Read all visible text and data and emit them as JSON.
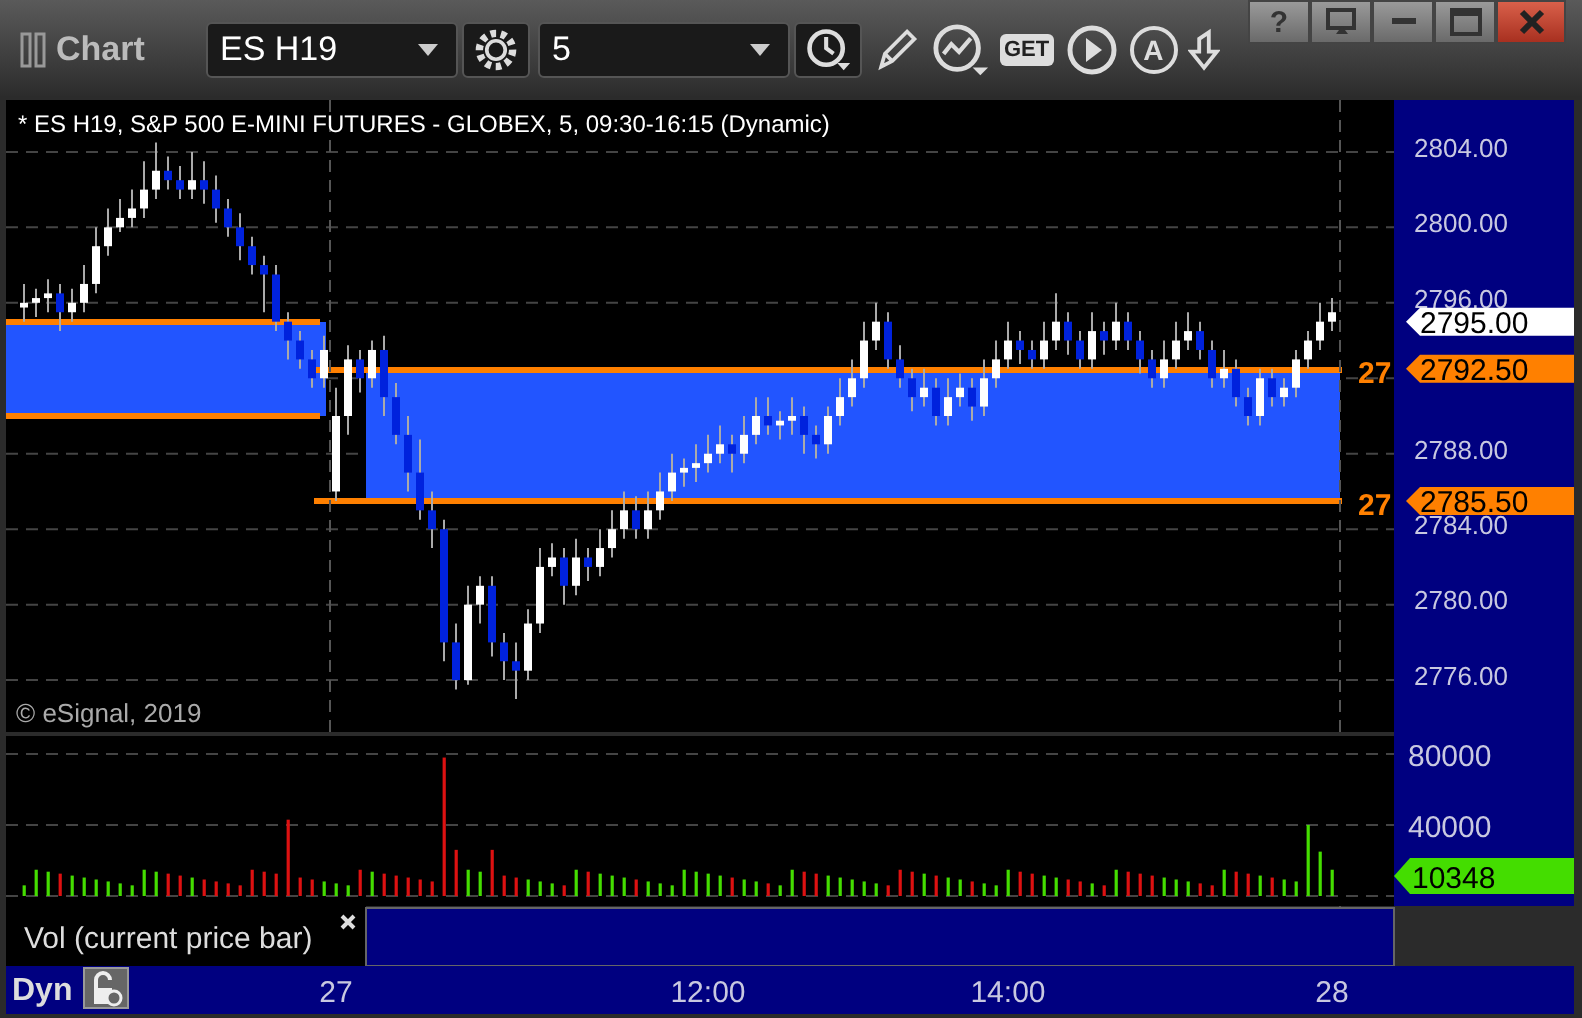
{
  "window": {
    "title": "Chart",
    "help_glyph": "?"
  },
  "toolbar": {
    "symbol": "ES H19",
    "interval": "5",
    "get_label": "GET",
    "a_label": "A"
  },
  "legend": "* ES H19, S&P 500 E-MINI FUTURES - GLOBEX, 5, 09:30-16:15 (Dynamic)",
  "watermark_note": "© eSignal, 2019",
  "price_chart": {
    "chart_data": {
      "type": "candlestick",
      "yticks": [
        {
          "value": 2804,
          "label": "2804.00"
        },
        {
          "value": 2800,
          "label": "2800.00"
        },
        {
          "value": 2796,
          "label": "2796.00"
        },
        {
          "value": 2788,
          "label": "2788.00"
        },
        {
          "value": 2784,
          "label": "2784.00"
        },
        {
          "value": 2780,
          "label": "2780.00"
        },
        {
          "value": 2776,
          "label": "2776.00"
        }
      ],
      "ylim": [
        2773.25,
        2806.75
      ],
      "categories": [
        null,
        null,
        null,
        null,
        null,
        null,
        null,
        null,
        null,
        null,
        null,
        null,
        null,
        null,
        null,
        null,
        null,
        null,
        null,
        null,
        null,
        null,
        null,
        null,
        null,
        null,
        null,
        null,
        null,
        null,
        null,
        null,
        null,
        null,
        null,
        null,
        null,
        null,
        null,
        null,
        null,
        null,
        null,
        null,
        null,
        null,
        null,
        null,
        null,
        null,
        null,
        null,
        null,
        null,
        null,
        null,
        null,
        null,
        null,
        null,
        null,
        null,
        null,
        null,
        null,
        null,
        null,
        null,
        null,
        null,
        null,
        null,
        null,
        null,
        null,
        null,
        null,
        null,
        null,
        null,
        null,
        null,
        null,
        null,
        null,
        null,
        null,
        null,
        null,
        null,
        null,
        null,
        null,
        null,
        null,
        null,
        null,
        null,
        null,
        null,
        null,
        null,
        null,
        null,
        null,
        null,
        null,
        null,
        null,
        null
      ],
      "ohlc": [
        [
          2795.75,
          2797,
          2795,
          2796
        ],
        [
          2796,
          2796.75,
          2795.25,
          2796.25
        ],
        [
          2796.25,
          2797.25,
          2795.5,
          2796.5
        ],
        [
          2796.5,
          2797,
          2794.5,
          2795.5
        ],
        [
          2795.5,
          2796.75,
          2795,
          2796
        ],
        [
          2796,
          2798,
          2795.5,
          2797
        ],
        [
          2797,
          2800,
          2796.5,
          2799
        ],
        [
          2799,
          2801,
          2798.5,
          2800
        ],
        [
          2800,
          2801.5,
          2799.75,
          2800.5
        ],
        [
          2800.5,
          2802,
          2800,
          2801
        ],
        [
          2801,
          2803.5,
          2800.5,
          2802
        ],
        [
          2802,
          2804.5,
          2801.5,
          2803
        ],
        [
          2803,
          2803.75,
          2802,
          2802.5
        ],
        [
          2802.5,
          2803.25,
          2801.5,
          2802
        ],
        [
          2802,
          2804,
          2801.5,
          2802.5
        ],
        [
          2802.5,
          2803.5,
          2801.25,
          2802
        ],
        [
          2802,
          2802.75,
          2800.25,
          2801
        ],
        [
          2801,
          2801.5,
          2799.5,
          2800
        ],
        [
          2800,
          2800.75,
          2798.25,
          2799
        ],
        [
          2799,
          2799.5,
          2797.5,
          2798
        ],
        [
          2798,
          2798.5,
          2795.5,
          2797.5
        ],
        [
          2797.5,
          2798,
          2794.5,
          2795
        ],
        [
          2795,
          2795.5,
          2793,
          2794
        ],
        [
          2794,
          2794.5,
          2792.5,
          2793
        ],
        [
          2793,
          2793.5,
          2791.5,
          2792
        ],
        [
          2792,
          2794.25,
          2791.5,
          2793.5
        ],
        [
          2786,
          2791.5,
          2785.5,
          2790
        ],
        [
          2790,
          2793.75,
          2789,
          2793
        ],
        [
          2793,
          2793.5,
          2791.25,
          2792
        ],
        [
          2792,
          2794,
          2791.5,
          2793.5
        ],
        [
          2793.5,
          2794.25,
          2790,
          2791
        ],
        [
          2791,
          2791.75,
          2788.5,
          2789
        ],
        [
          2789,
          2790,
          2786,
          2787
        ],
        [
          2787,
          2788.75,
          2784.5,
          2785
        ],
        [
          2785,
          2786,
          2783,
          2784
        ],
        [
          2784,
          2784.5,
          2777,
          2778
        ],
        [
          2778,
          2779,
          2775.5,
          2776
        ],
        [
          2776,
          2781,
          2775.75,
          2780
        ],
        [
          2780,
          2781.5,
          2779,
          2781
        ],
        [
          2781,
          2781.5,
          2777.25,
          2778
        ],
        [
          2778,
          2778.5,
          2776,
          2777
        ],
        [
          2777,
          2778,
          2775,
          2776.5
        ],
        [
          2776.5,
          2779.75,
          2776,
          2779
        ],
        [
          2779,
          2783,
          2778.5,
          2782
        ],
        [
          2782,
          2783.25,
          2781.5,
          2782.5
        ],
        [
          2782.5,
          2783,
          2780,
          2781
        ],
        [
          2781,
          2783.5,
          2780.5,
          2782.5
        ],
        [
          2782.5,
          2783,
          2781.25,
          2782
        ],
        [
          2782,
          2784,
          2781.5,
          2783
        ],
        [
          2783,
          2785,
          2782.5,
          2784
        ],
        [
          2784,
          2786,
          2783.5,
          2785
        ],
        [
          2785,
          2785.75,
          2783.5,
          2784
        ],
        [
          2784,
          2786,
          2783.5,
          2785
        ],
        [
          2785,
          2787,
          2784.5,
          2786
        ],
        [
          2786,
          2788,
          2785.5,
          2787
        ],
        [
          2787,
          2787.75,
          2786.25,
          2787.25
        ],
        [
          2787.25,
          2788.5,
          2786.5,
          2787.5
        ],
        [
          2787.5,
          2789,
          2787,
          2788
        ],
        [
          2788,
          2789.5,
          2787.5,
          2788.5
        ],
        [
          2788.5,
          2789,
          2787,
          2788
        ],
        [
          2788,
          2790,
          2787.5,
          2789
        ],
        [
          2789,
          2791,
          2788.5,
          2790
        ],
        [
          2790,
          2791,
          2789,
          2789.5
        ],
        [
          2789.5,
          2790.25,
          2788.75,
          2789.75
        ],
        [
          2789.75,
          2791,
          2789,
          2790
        ],
        [
          2790,
          2790.5,
          2788,
          2789
        ],
        [
          2789,
          2789.5,
          2787.75,
          2788.5
        ],
        [
          2788.5,
          2790.5,
          2788,
          2790
        ],
        [
          2790,
          2792,
          2789.5,
          2791
        ],
        [
          2791,
          2793,
          2790.5,
          2792
        ],
        [
          2792,
          2795,
          2791.5,
          2794
        ],
        [
          2794,
          2796,
          2793.5,
          2795
        ],
        [
          2795,
          2795.5,
          2792.5,
          2793
        ],
        [
          2793,
          2793.75,
          2791.5,
          2792
        ],
        [
          2792,
          2792.5,
          2790.25,
          2791
        ],
        [
          2791,
          2792.5,
          2790.5,
          2791.5
        ],
        [
          2791.5,
          2792,
          2789.5,
          2790
        ],
        [
          2790,
          2792,
          2789.5,
          2791
        ],
        [
          2791,
          2792.25,
          2790.5,
          2791.5
        ],
        [
          2791.5,
          2792,
          2789.75,
          2790.5
        ],
        [
          2790.5,
          2793,
          2790,
          2792
        ],
        [
          2792,
          2794,
          2791.5,
          2793
        ],
        [
          2793,
          2795,
          2792.5,
          2794
        ],
        [
          2794,
          2794.5,
          2792.75,
          2793.5
        ],
        [
          2793.5,
          2794,
          2792.5,
          2793
        ],
        [
          2793,
          2795,
          2792.5,
          2794
        ],
        [
          2794,
          2796.5,
          2793.5,
          2795
        ],
        [
          2795,
          2795.5,
          2793.25,
          2794
        ],
        [
          2794,
          2794.5,
          2792.5,
          2793
        ],
        [
          2793,
          2795.5,
          2792.5,
          2794.5
        ],
        [
          2794.5,
          2795,
          2793.25,
          2794
        ],
        [
          2794,
          2796,
          2793.5,
          2795
        ],
        [
          2795,
          2795.5,
          2793.5,
          2794
        ],
        [
          2794,
          2794.5,
          2792.25,
          2793
        ],
        [
          2793,
          2793.5,
          2791.5,
          2792
        ],
        [
          2792,
          2794,
          2791.5,
          2793
        ],
        [
          2793,
          2795,
          2792.5,
          2794
        ],
        [
          2794,
          2795.5,
          2793.5,
          2794.5
        ],
        [
          2794.5,
          2795,
          2793,
          2793.5
        ],
        [
          2793.5,
          2794,
          2791.5,
          2792
        ],
        [
          2792,
          2793.5,
          2791.5,
          2792.5
        ],
        [
          2792.5,
          2793,
          2790.5,
          2791
        ],
        [
          2791,
          2791.5,
          2789.5,
          2790
        ],
        [
          2790,
          2792.5,
          2789.5,
          2792
        ],
        [
          2792,
          2792.5,
          2790.5,
          2791
        ],
        [
          2791,
          2792,
          2790.5,
          2791.5
        ],
        [
          2791.5,
          2793.5,
          2791,
          2793
        ],
        [
          2793,
          2794.5,
          2792.5,
          2794
        ],
        [
          2794,
          2796,
          2793.5,
          2795
        ],
        [
          2795,
          2796.25,
          2794.5,
          2795.5
        ]
      ]
    }
  },
  "price_tags": [
    {
      "label": "2795.00",
      "kind": "last"
    },
    {
      "label": "2792.50",
      "kind": "level",
      "edge_label": "27"
    },
    {
      "label": "2785.50",
      "kind": "level",
      "edge_label": "27"
    }
  ],
  "volume_pane": {
    "study_label": "Vol (current price bar)",
    "ticks": [
      "80000",
      "40000"
    ],
    "tag": "10348"
  },
  "time_axis": {
    "mode": "Dyn",
    "labels": [
      "27",
      "12:00",
      "14:00",
      "28"
    ]
  }
}
